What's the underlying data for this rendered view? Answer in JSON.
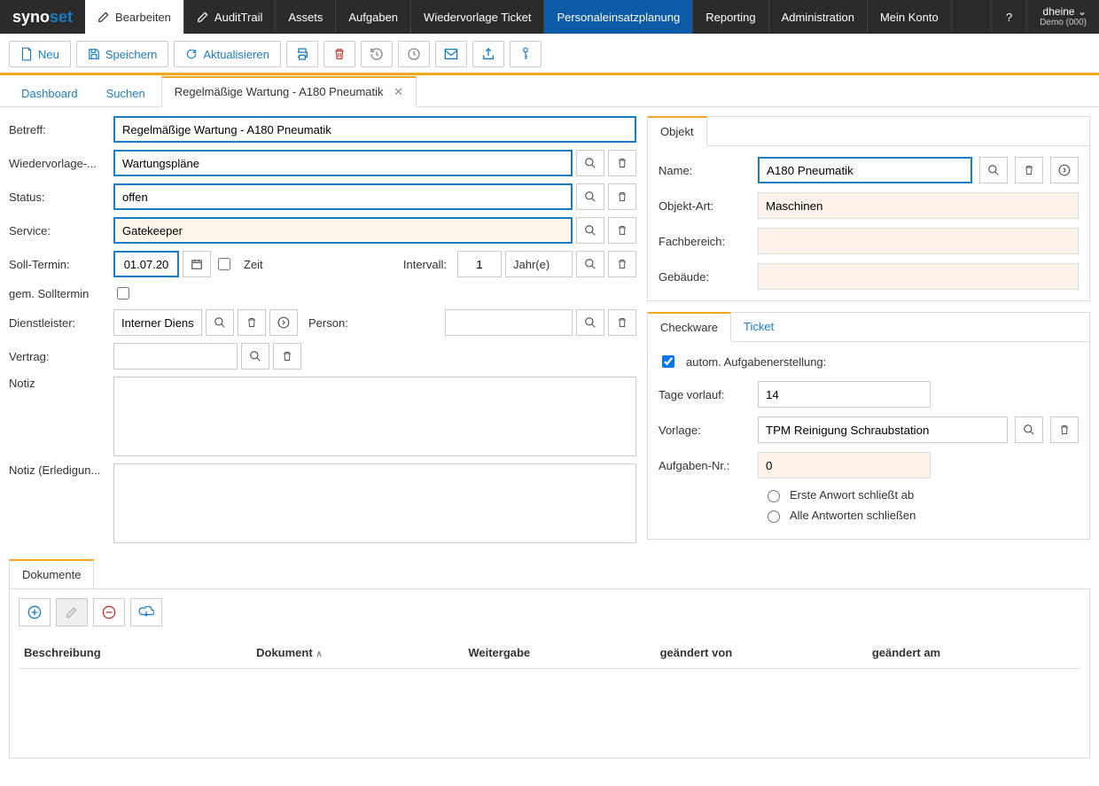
{
  "brand": {
    "part1": "syno",
    "part2": "set"
  },
  "topnav": {
    "items": [
      {
        "label": "Bearbeiten",
        "icon": "edit",
        "active": true
      },
      {
        "label": "AuditTrail",
        "icon": "edit",
        "active": false
      },
      {
        "label": "Assets"
      },
      {
        "label": "Aufgaben"
      },
      {
        "label": "Wiedervorlage Ticket"
      },
      {
        "label": "Personaleinsatzplanung",
        "highlight": true
      },
      {
        "label": "Reporting"
      },
      {
        "label": "Administration"
      },
      {
        "label": "Mein Konto"
      }
    ],
    "help": "?",
    "user": {
      "name": "dheine",
      "sub": "Demo (000)"
    }
  },
  "toolbar": {
    "neu": "Neu",
    "speichern": "Speichern",
    "aktualisieren": "Aktualisieren"
  },
  "subtabs": {
    "dashboard": "Dashboard",
    "suchen": "Suchen",
    "active": "Regelmäßige Wartung - A180 Pneumatik"
  },
  "form": {
    "betreff_label": "Betreff:",
    "betreff": "Regelmäßige Wartung - A180 Pneumatik",
    "wiedervorlage_label": "Wiedervorlage-...",
    "wiedervorlage": "Wartungspläne",
    "status_label": "Status:",
    "status": "offen",
    "service_label": "Service:",
    "service": "Gatekeeper",
    "solltermin_label": "Soll-Termin:",
    "solltermin": "01.07.20",
    "zeit_label": "Zeit",
    "intervall_label": "Intervall:",
    "intervall_value": "1",
    "intervall_unit": "Jahr(e)",
    "gem_solltermin_label": "gem. Solltermin",
    "dienstleister_label": "Dienstleister:",
    "dienstleister": "Interner Dienstle",
    "person_label": "Person:",
    "person": "",
    "vertrag_label": "Vertrag:",
    "vertrag": "",
    "notiz_label": "Notiz",
    "notiz_erledigung_label": "Notiz (Erledigun..."
  },
  "objekt": {
    "tab": "Objekt",
    "name_label": "Name:",
    "name": "A180 Pneumatik",
    "art_label": "Objekt-Art:",
    "art": "Maschinen",
    "fachbereich_label": "Fachbereich:",
    "fachbereich": "",
    "gebaeude_label": "Gebäude:",
    "gebaeude": ""
  },
  "checkware": {
    "tab_checkware": "Checkware",
    "tab_ticket": "Ticket",
    "autom_label": "autom. Aufgabenerstellung:",
    "tage_vorlauf_label": "Tage vorlauf:",
    "tage_vorlauf": "14",
    "vorlage_label": "Vorlage:",
    "vorlage": "TPM Reinigung Schraubstation",
    "aufgaben_nr_label": "Aufgaben-Nr.:",
    "aufgaben_nr": "0",
    "radio1": "Erste Anwort schließt ab",
    "radio2": "Alle Antworten schließen"
  },
  "docs": {
    "tab": "Dokumente",
    "cols": {
      "beschreibung": "Beschreibung",
      "dokument": "Dokument",
      "weitergabe": "Weitergabe",
      "geandert_von": "geändert von",
      "geandert_am": "geändert am"
    }
  }
}
